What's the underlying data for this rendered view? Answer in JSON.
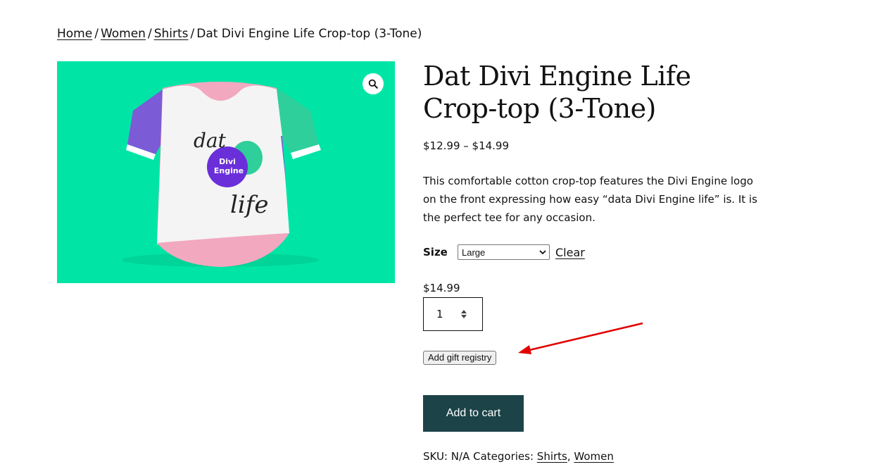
{
  "breadcrumb": {
    "home": "Home",
    "women": "Women",
    "shirts": "Shirts",
    "separator": "/",
    "current": "Dat Divi Engine Life Crop-top (3-Tone)"
  },
  "product": {
    "title": "Dat Divi Engine Life Crop-top (3-Tone)",
    "price_range": "$12.99 – $14.99",
    "description": "This comfortable cotton crop-top features the Divi Engine logo on the front expressing how easy “data Divi Engine life” is. It is the perfect tee for any occasion.",
    "image": {
      "background": "#00e5a6",
      "graphic_text_1": "dat",
      "graphic_text_2": "Divi",
      "graphic_text_3": "Engine",
      "graphic_text_4": "life",
      "zoom_icon": "magnifier-icon"
    }
  },
  "variation": {
    "size_label": "Size",
    "size_selected": "Large",
    "clear_label": "Clear",
    "price": "$14.99"
  },
  "quantity": {
    "value": "1"
  },
  "gift_registry_button": "Add gift registry",
  "add_to_cart_button": "Add to cart",
  "meta": {
    "sku_label": "SKU:",
    "sku_value": "N/A",
    "categories_label": "Categories:",
    "category_1": "Shirts",
    "category_sep": ",",
    "category_2": "Women"
  },
  "colors": {
    "button_bg": "#1c4448",
    "annotation_arrow": "#e00000"
  }
}
